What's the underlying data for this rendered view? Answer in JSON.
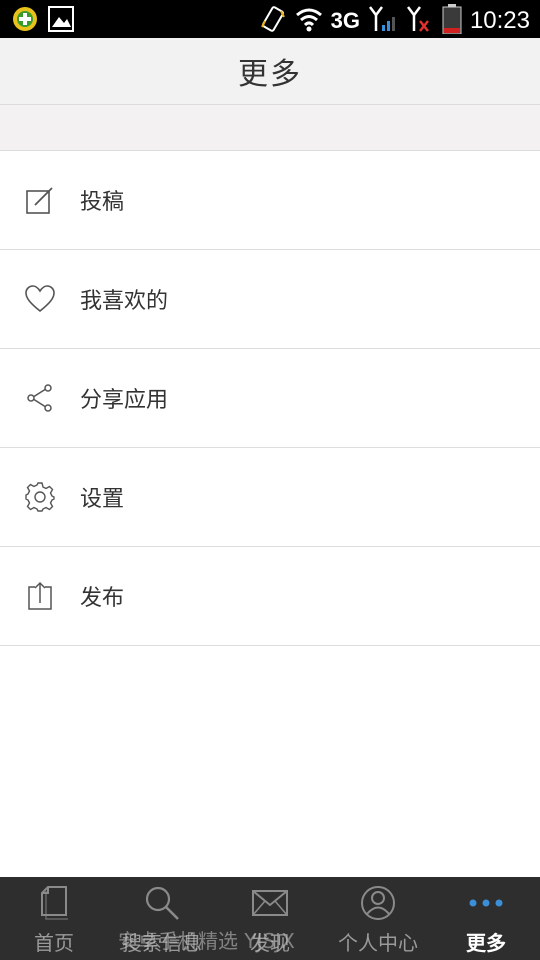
{
  "status_bar": {
    "network": "3G",
    "time": "10:23"
  },
  "header": {
    "title": "更多"
  },
  "menu": {
    "items": [
      {
        "label": "投稿",
        "icon": "edit-icon"
      },
      {
        "label": "我喜欢的",
        "icon": "heart-icon"
      },
      {
        "label": "分享应用",
        "icon": "share-icon"
      },
      {
        "label": "设置",
        "icon": "gear-icon"
      },
      {
        "label": "发布",
        "icon": "upload-icon"
      }
    ]
  },
  "tabs": [
    {
      "label": "首页",
      "icon": "document-icon"
    },
    {
      "label": "搜索信息",
      "icon": "search-icon"
    },
    {
      "label": "发现",
      "icon": "mail-icon"
    },
    {
      "label": "个人中心",
      "icon": "user-icon"
    },
    {
      "label": "更多",
      "icon": "more-dots-icon",
      "active": true
    }
  ],
  "watermark": "安卓手机精选 YJSJX",
  "colors": {
    "status_bar_bg": "#000000",
    "header_bg": "#f2f2f2",
    "tab_bar_bg": "#2e2e2e",
    "active_tab_icon": "#3a8fd8"
  }
}
